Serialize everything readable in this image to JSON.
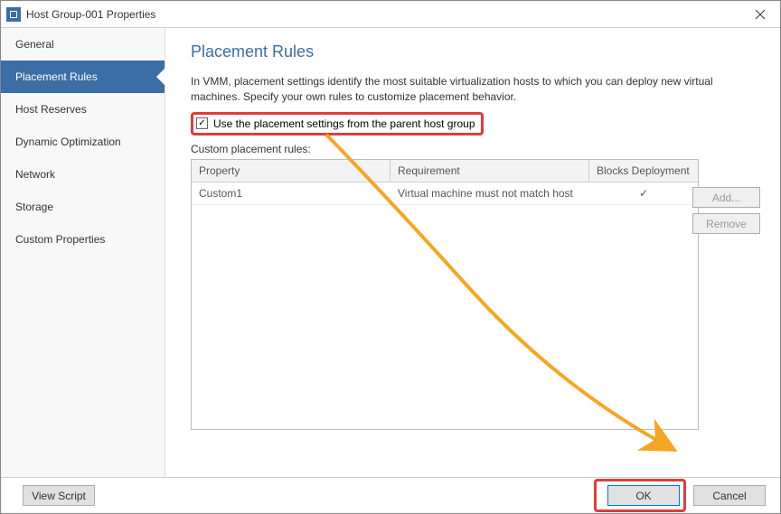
{
  "titlebar": {
    "title": "Host Group-001 Properties"
  },
  "sidebar": {
    "items": [
      {
        "label": "General"
      },
      {
        "label": "Placement Rules"
      },
      {
        "label": "Host Reserves"
      },
      {
        "label": "Dynamic Optimization"
      },
      {
        "label": "Network"
      },
      {
        "label": "Storage"
      },
      {
        "label": "Custom Properties"
      }
    ],
    "activeIndex": 1
  },
  "content": {
    "title": "Placement Rules",
    "description": "In VMM, placement settings identify the most suitable virtualization hosts to which you can deploy new virtual machines. Specify your own rules to customize placement behavior.",
    "checkbox_label": "Use the placement settings from the parent host group",
    "checkbox_checked": true,
    "section_label": "Custom placement rules:",
    "table": {
      "headers": {
        "property": "Property",
        "requirement": "Requirement",
        "blocks": "Blocks Deployment"
      },
      "rows": [
        {
          "property": "Custom1",
          "requirement": "Virtual machine must not match host",
          "blocks": "✓"
        }
      ]
    },
    "add_btn": "Add...",
    "remove_btn": "Remove"
  },
  "footer": {
    "view_script": "View Script",
    "ok": "OK",
    "cancel": "Cancel"
  }
}
